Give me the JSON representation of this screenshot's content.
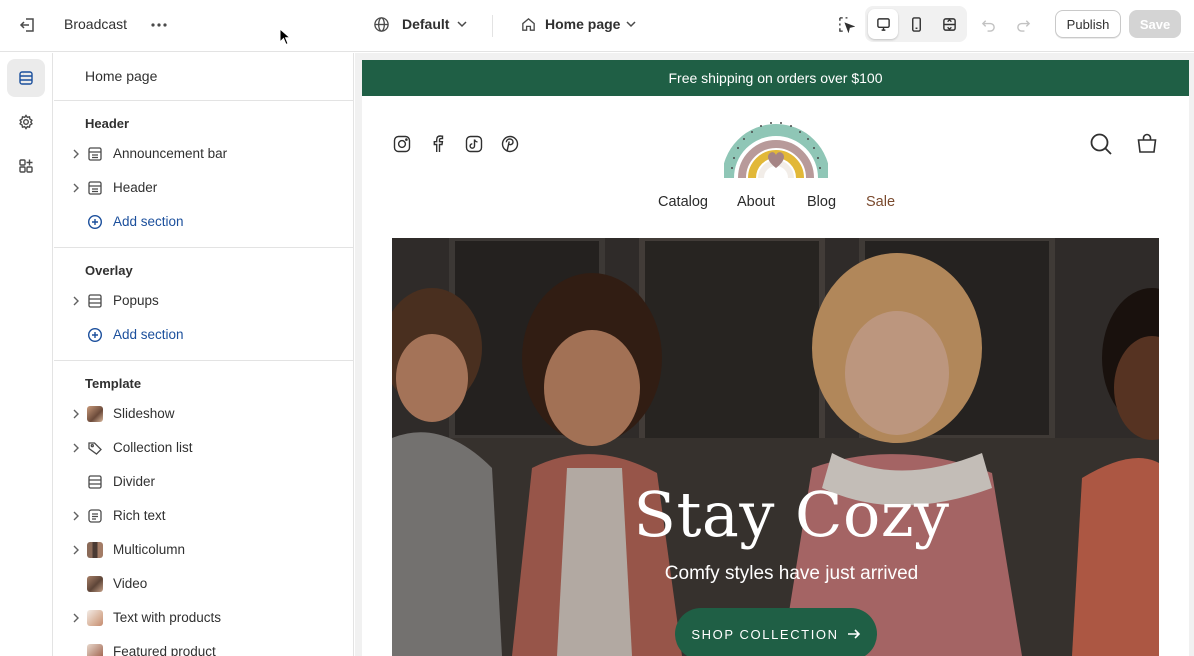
{
  "topbar": {
    "store_name": "Broadcast",
    "theme_selector": "Default",
    "page_selector": "Home page",
    "publish_label": "Publish",
    "save_label": "Save"
  },
  "sidebar": {
    "title": "Home page",
    "groups": {
      "header": "Header",
      "overlay": "Overlay",
      "template": "Template"
    },
    "header_items": [
      "Announcement bar",
      "Header"
    ],
    "overlay_items": [
      "Popups"
    ],
    "template_items": [
      "Slideshow",
      "Collection list",
      "Divider",
      "Rich text",
      "Multicolumn",
      "Video",
      "Text with products",
      "Featured product"
    ],
    "add_section_label": "Add section"
  },
  "preview": {
    "announcement": "Free shipping on orders over $100",
    "nav": [
      "Catalog",
      "About",
      "Blog",
      "Sale"
    ],
    "hero_title": "Stay Cozy",
    "hero_subtitle": "Comfy styles have just arrived",
    "hero_button": "SHOP COLLECTION"
  },
  "colors": {
    "brand_green": "#1f5f45",
    "link_blue": "#1b4f9c",
    "sale": "#7a4a2e"
  }
}
